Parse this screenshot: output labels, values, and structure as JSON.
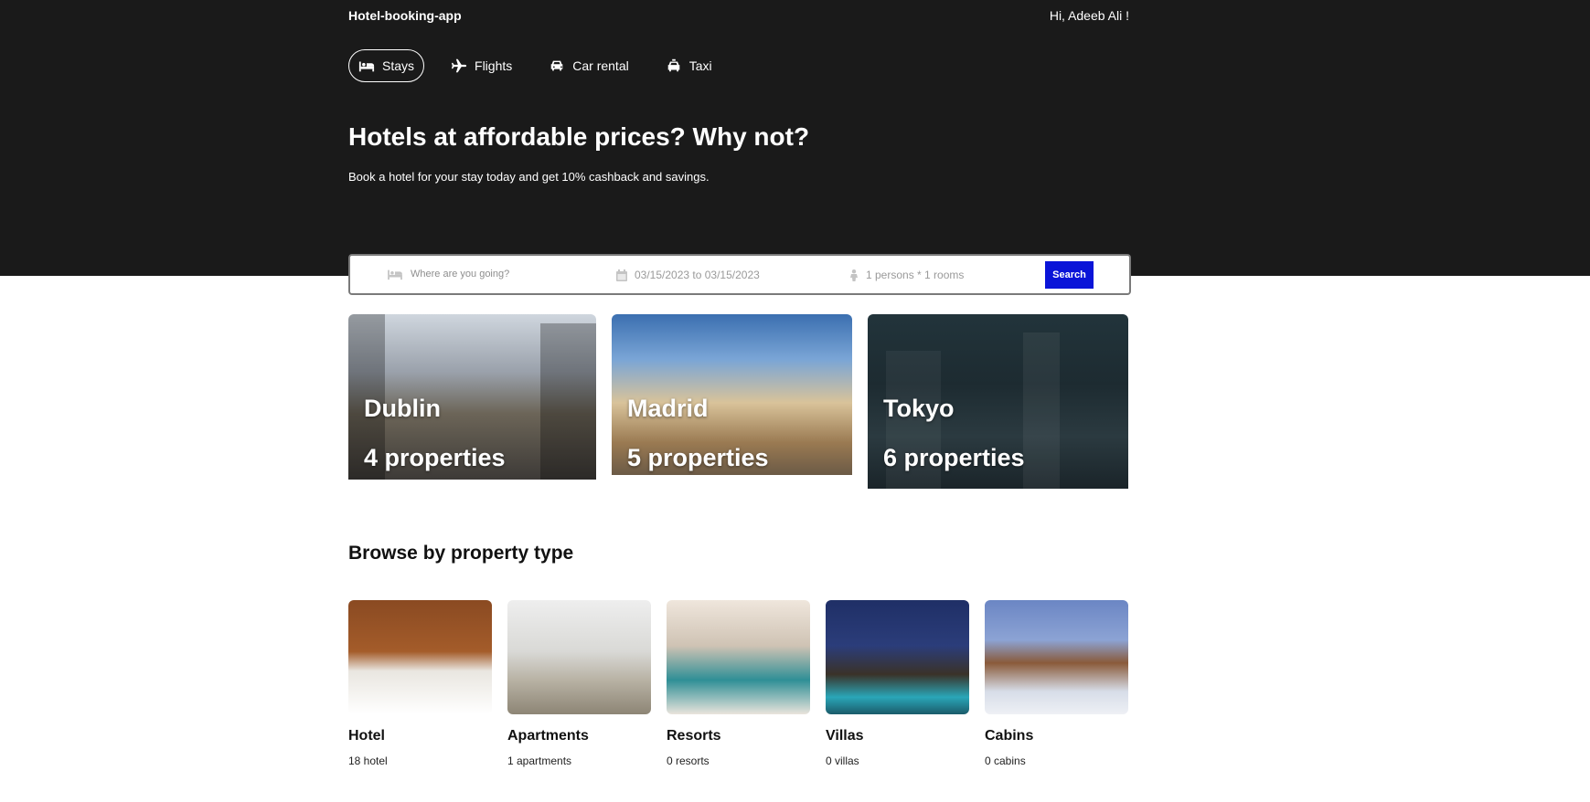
{
  "header": {
    "brand": "Hotel-booking-app",
    "greeting": "Hi, Adeeb Ali !"
  },
  "nav": {
    "items": [
      {
        "label": "Stays",
        "icon": "bed-icon",
        "active": true
      },
      {
        "label": "Flights",
        "icon": "plane-icon",
        "active": false
      },
      {
        "label": "Car rental",
        "icon": "car-icon",
        "active": false
      },
      {
        "label": "Taxi",
        "icon": "taxi-icon",
        "active": false
      }
    ]
  },
  "hero": {
    "title": "Hotels at affordable prices? Why not?",
    "subtitle": "Book a hotel for your stay today and get 10% cashback and savings."
  },
  "search": {
    "destination_placeholder": "Where are you going?",
    "dates": "03/15/2023 to 03/15/2023",
    "guests": "1 persons * 1 rooms",
    "button": "Search"
  },
  "featured": [
    {
      "city": "Dublin",
      "properties": "4 properties"
    },
    {
      "city": "Madrid",
      "properties": "5 properties"
    },
    {
      "city": "Tokyo",
      "properties": "6 properties"
    }
  ],
  "property_types": {
    "title": "Browse by property type",
    "items": [
      {
        "name": "Hotel",
        "count": "18 hotel"
      },
      {
        "name": "Apartments",
        "count": "1 apartments"
      },
      {
        "name": "Resorts",
        "count": "0 resorts"
      },
      {
        "name": "Villas",
        "count": "0 villas"
      },
      {
        "name": "Cabins",
        "count": "0 cabins"
      }
    ]
  },
  "colors": {
    "header_bg": "#1a1a1a",
    "search_button": "#0a14d8"
  }
}
